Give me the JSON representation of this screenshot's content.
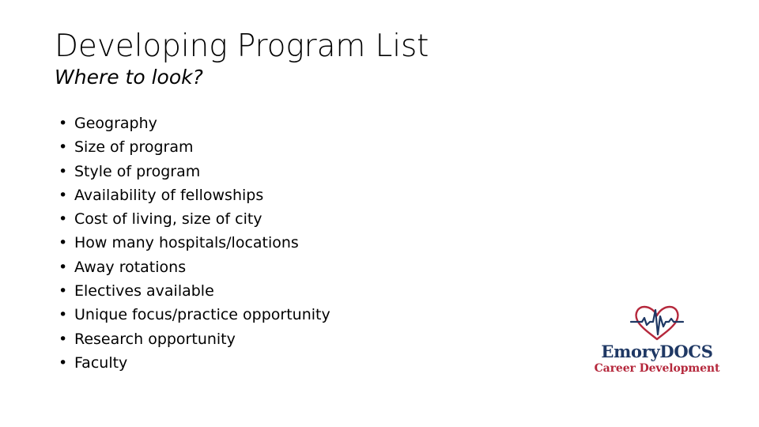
{
  "slide": {
    "title": "Developing Program List",
    "subtitle": "Where to look?",
    "bullet_marker": "•",
    "bullets": [
      {
        "text": "Geography"
      },
      {
        "text": "Size of program"
      },
      {
        "text": "Style of program"
      },
      {
        "text": "Availability of fellowships"
      },
      {
        "text": "Cost of living, size of city"
      },
      {
        "text": "How many hospitals/locations"
      },
      {
        "text": "Away rotations"
      },
      {
        "text": "Electives available"
      },
      {
        "text": "Unique focus/practice opportunity"
      },
      {
        "text": "Research opportunity"
      },
      {
        "text": "Faculty"
      }
    ]
  },
  "logo": {
    "icon_name": "heart-ekg-icon",
    "wordmark": "EmoryDOCS",
    "tagline": "Career Development",
    "colors": {
      "heart_red": "#B5283C",
      "ekg_navy": "#1F3864",
      "wordmark_navy": "#1F3864",
      "tagline_red": "#B5283C"
    }
  },
  "background_color": "#FFFFFF"
}
